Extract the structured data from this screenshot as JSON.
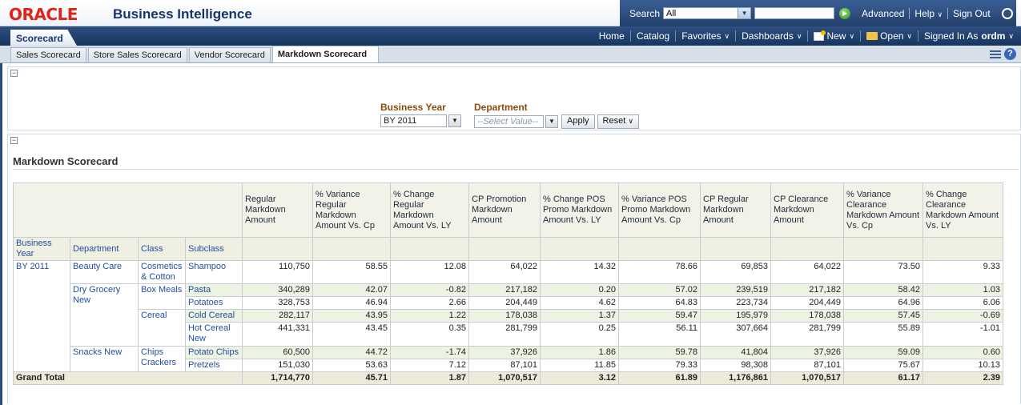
{
  "header": {
    "logo": "ORACLE",
    "product": "Business Intelligence",
    "search_label": "Search",
    "search_scope": "All",
    "search_text": "",
    "advanced": "Advanced",
    "help": "Help",
    "sign_out": "Sign Out"
  },
  "nav": {
    "app_tab": "Scorecard",
    "home": "Home",
    "catalog": "Catalog",
    "favorites": "Favorites",
    "dashboards": "Dashboards",
    "new": "New",
    "open": "Open",
    "signed_in_as": "Signed In As",
    "user": "ordm"
  },
  "pagetabs": [
    "Sales Scorecard",
    "Store Sales Scorecard",
    "Vendor Scorecard",
    "Markdown Scorecard"
  ],
  "prompts": {
    "business_year_label": "Business Year",
    "business_year_value": "BY 2011",
    "department_label": "Department",
    "department_placeholder": "--Select Value--",
    "apply": "Apply",
    "reset": "Reset"
  },
  "report": {
    "title": "Markdown Scorecard",
    "measure_headers": [
      "Regular Markdown Amount",
      "% Variance Regular Markdown Amount Vs. Cp",
      "% Change Regular Markdown Amount Vs. LY",
      "CP Promotion Markdown Amount",
      "% Change POS Promo Markdown Amount Vs. LY",
      "% Variance POS Promo Markdown Amount Vs. Cp",
      "CP Regular Markdown Amount",
      "CP Clearance Markdown Amount",
      "% Variance Clearance Markdown Amount Vs. Cp",
      "% Change Clearance Markdown Amount Vs. LY"
    ],
    "dim_headers": [
      "Business Year",
      "Department",
      "Class",
      "Subclass"
    ],
    "year": "BY 2011",
    "departments": [
      "Beauty Care",
      "Dry Grocery New",
      "Snacks New"
    ],
    "classes": [
      "Cosmetics & Cotton",
      "Box Meals",
      "Cereal",
      "Chips Crackers"
    ],
    "rows": [
      {
        "subclass": "Shampoo",
        "values": [
          "110,750",
          "58.55",
          "12.08",
          "64,022",
          "14.32",
          "78.66",
          "69,853",
          "64,022",
          "73.50",
          "9.33"
        ]
      },
      {
        "subclass": "Pasta",
        "values": [
          "340,289",
          "42.07",
          "-0.82",
          "217,182",
          "0.20",
          "57.02",
          "239,519",
          "217,182",
          "58.42",
          "1.03"
        ]
      },
      {
        "subclass": "Potatoes",
        "values": [
          "328,753",
          "46.94",
          "2.66",
          "204,449",
          "4.62",
          "64.83",
          "223,734",
          "204,449",
          "64.96",
          "6.06"
        ]
      },
      {
        "subclass": "Cold Cereal",
        "values": [
          "282,117",
          "43.95",
          "1.22",
          "178,038",
          "1.37",
          "59.47",
          "195,979",
          "178,038",
          "57.45",
          "-0.69"
        ]
      },
      {
        "subclass": "Hot Cereal New",
        "values": [
          "441,331",
          "43.45",
          "0.35",
          "281,799",
          "0.25",
          "56.11",
          "307,664",
          "281,799",
          "55.89",
          "-1.01"
        ]
      },
      {
        "subclass": "Potato Chips",
        "values": [
          "60,500",
          "44.72",
          "-1.74",
          "37,926",
          "1.86",
          "59.78",
          "41,804",
          "37,926",
          "59.09",
          "0.60"
        ]
      },
      {
        "subclass": "Pretzels",
        "values": [
          "151,030",
          "53.63",
          "7.12",
          "87,101",
          "11.85",
          "79.33",
          "98,308",
          "87,101",
          "75.67",
          "10.13"
        ]
      }
    ],
    "grand_total_label": "Grand Total",
    "grand_total": [
      "1,714,770",
      "45.71",
      "1.87",
      "1,070,517",
      "3.12",
      "61.89",
      "1,176,861",
      "1,070,517",
      "61.17",
      "2.39"
    ]
  }
}
